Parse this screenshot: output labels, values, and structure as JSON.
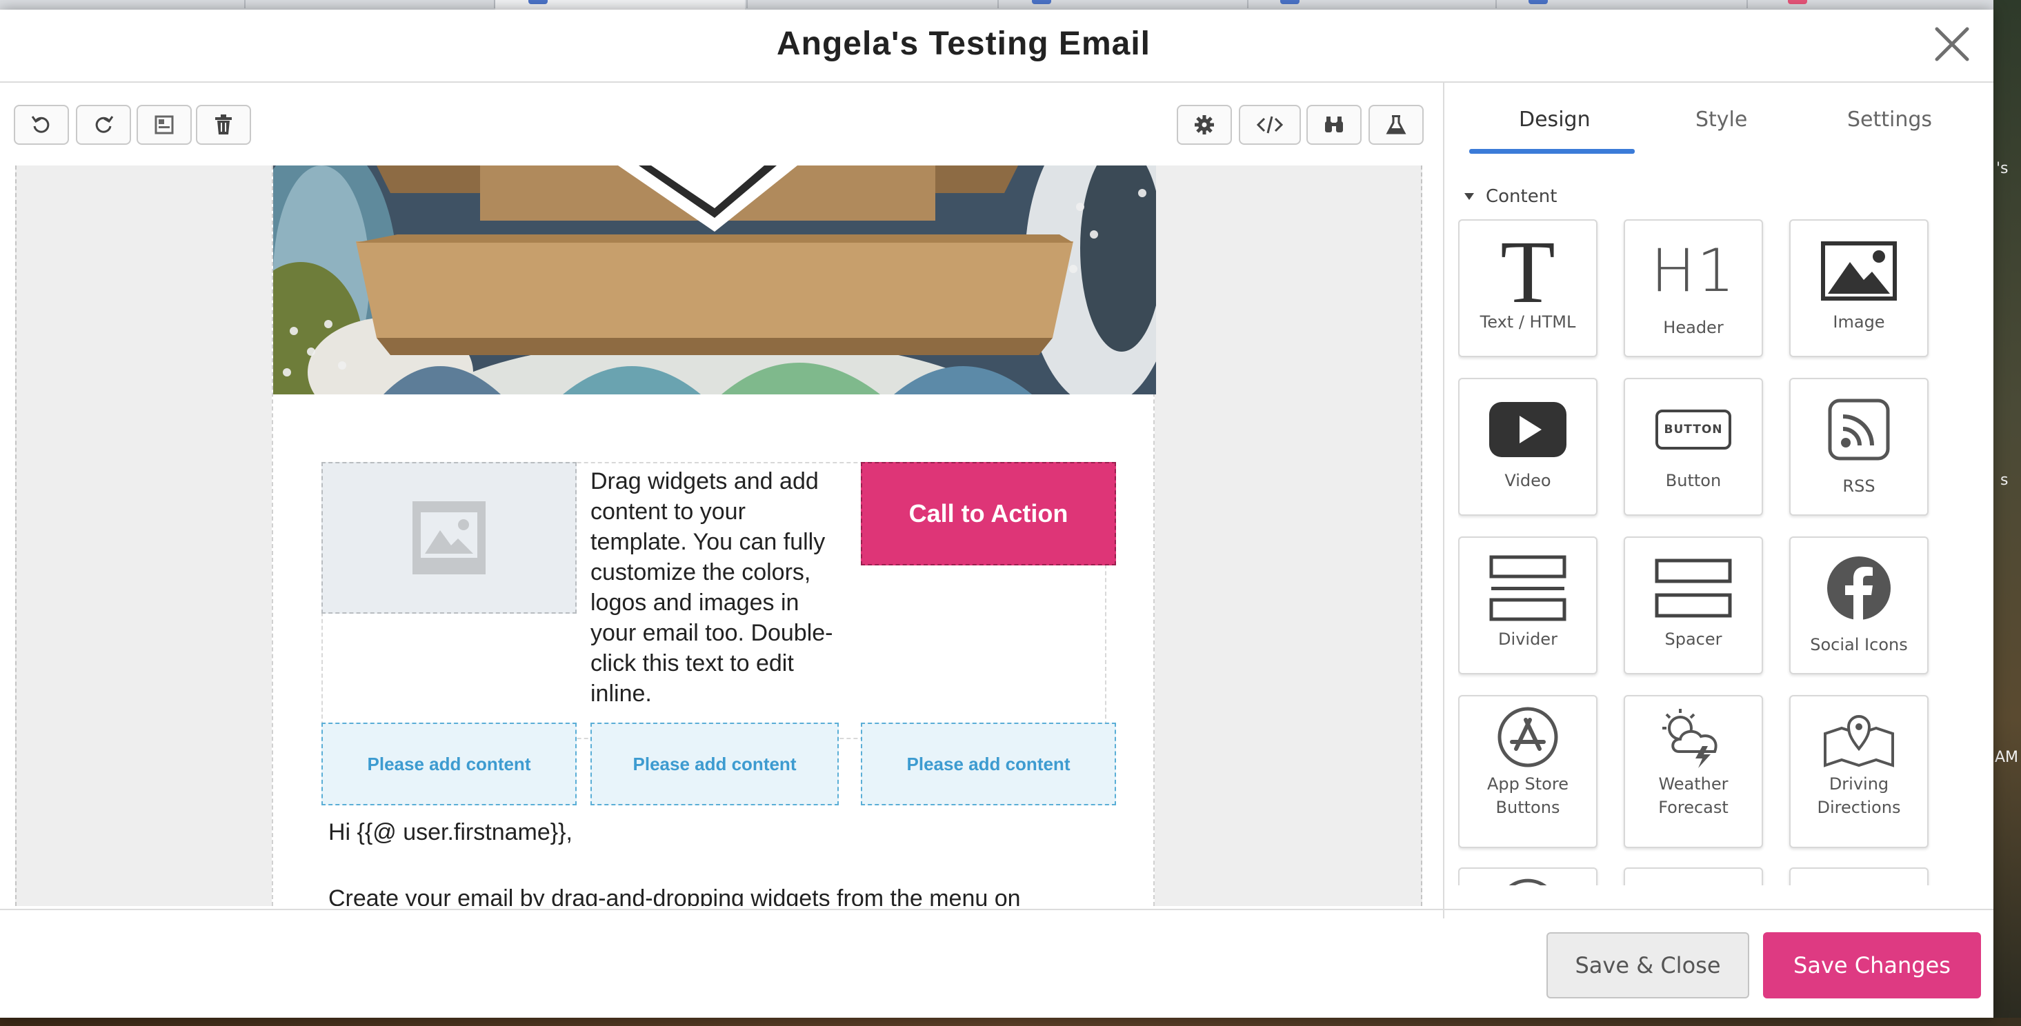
{
  "modal": {
    "title": "Angela's Testing Email"
  },
  "desktop": {
    "fragments": [
      "'s",
      "s",
      "AM"
    ]
  },
  "toolbar": {
    "left_icons": [
      "undo-icon",
      "redo-icon",
      "template-icon",
      "trash-icon"
    ],
    "right_icons": [
      "gear-icon",
      "code-icon",
      "binoculars-icon",
      "flask-icon"
    ]
  },
  "email": {
    "body_text": "Drag widgets and add content to your template. You can fully customize the colors, logos and images in your email too. Double-click this text to edit inline.",
    "cta_label": "Call to Action",
    "add_content_label": "Please add content",
    "greeting": "Hi {{@ user.firstname}},",
    "intro": "Create your email by drag-and-dropping widgets from the menu on"
  },
  "panel": {
    "tabs": [
      "Design",
      "Style",
      "Settings"
    ],
    "active_tab": "Design",
    "section": "Content",
    "widgets": [
      {
        "label": "Text / HTML",
        "icon": "text-icon"
      },
      {
        "label": "Header",
        "icon": "h1-icon",
        "glyph": "H1"
      },
      {
        "label": "Image",
        "icon": "image-icon"
      },
      {
        "label": "Video",
        "icon": "video-icon"
      },
      {
        "label": "Button",
        "icon": "button-icon",
        "glyph": "BUTTON"
      },
      {
        "label": "RSS",
        "icon": "rss-icon"
      },
      {
        "label": "Divider",
        "icon": "divider-icon"
      },
      {
        "label": "Spacer",
        "icon": "spacer-icon"
      },
      {
        "label": "Social Icons",
        "icon": "facebook-icon"
      },
      {
        "label": "App Store Buttons",
        "icon": "app-store-icon"
      },
      {
        "label": "Weather Forecast",
        "icon": "weather-icon"
      },
      {
        "label": "Driving Directions",
        "icon": "map-pin-icon"
      }
    ]
  },
  "footer": {
    "save_close": "Save & Close",
    "save_changes": "Save Changes"
  },
  "colors": {
    "accent_pink": "#de3a82",
    "tab_blue": "#3b7bd8",
    "link_blue": "#3d9bd0"
  }
}
